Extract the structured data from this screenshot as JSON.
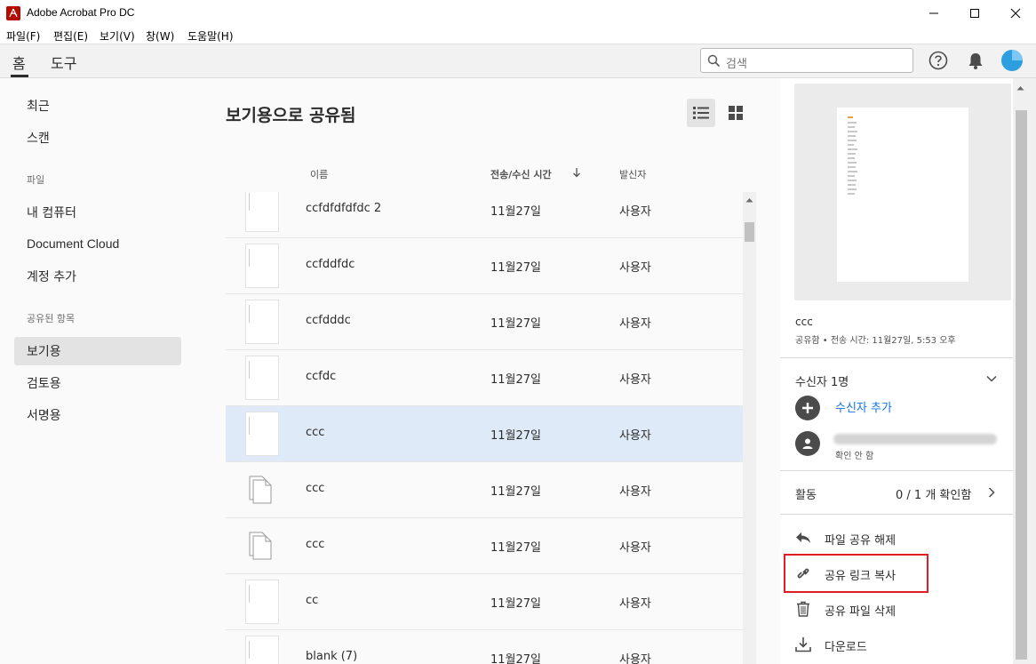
{
  "window": {
    "title": "Adobe Acrobat Pro DC"
  },
  "menu": [
    "파일(F)",
    "편집(E)",
    "보기(V)",
    "창(W)",
    "도움말(H)"
  ],
  "tabs": {
    "home": "홈",
    "tools": "도구"
  },
  "search": {
    "placeholder": "검색"
  },
  "sidebar": {
    "recent": "최근",
    "scan": "스캔",
    "files_head": "파일",
    "my_computer": "내 컴퓨터",
    "document_cloud": "Document Cloud",
    "add_account": "계정 추가",
    "shared_head": "공유된 항목",
    "view": "보기용",
    "review": "검토용",
    "sign": "서명용"
  },
  "main": {
    "title": "보기용으로 공유됨",
    "columns": {
      "name": "이름",
      "time": "전송/수신 시간",
      "sender": "발신자"
    },
    "rows": [
      {
        "name": "ccfdfdfdfdc 2",
        "time": "11월27일",
        "sender": "사용자",
        "thumb": "page"
      },
      {
        "name": "ccfddfdc",
        "time": "11월27일",
        "sender": "사용자",
        "thumb": "page"
      },
      {
        "name": "ccfdddc",
        "time": "11월27일",
        "sender": "사용자",
        "thumb": "page"
      },
      {
        "name": "ccfdc",
        "time": "11월27일",
        "sender": "사용자",
        "thumb": "page"
      },
      {
        "name": "ccc",
        "time": "11월27일",
        "sender": "사용자",
        "thumb": "page",
        "selected": true
      },
      {
        "name": "ccc",
        "time": "11월27일",
        "sender": "사용자",
        "thumb": "files-icon"
      },
      {
        "name": "ccc",
        "time": "11월27일",
        "sender": "사용자",
        "thumb": "files-icon"
      },
      {
        "name": "cc",
        "time": "11월27일",
        "sender": "사용자",
        "thumb": "page"
      },
      {
        "name": "blank (7)",
        "time": "11월27일",
        "sender": "사용자",
        "thumb": "page"
      }
    ]
  },
  "details": {
    "filename": "ccc",
    "meta": "공유함 • 전송 시간: 11월27일, 5:53 오후",
    "recipients": "수신자 1명",
    "add_recipient": "수신자 추가",
    "recipient_status": "확인 안 함",
    "activity": "활동",
    "activity_count": "0 / 1 개 확인함",
    "actions": {
      "unshare": "파일 공유 해제",
      "copy_link": "공유 링크 복사",
      "delete": "공유 파일 삭제",
      "download": "다운로드"
    }
  },
  "colors": {
    "accent": "#1473e6",
    "highlight": "#e01c24",
    "selected_row": "#dfeaf8",
    "avatar": "#2d9ee0"
  }
}
